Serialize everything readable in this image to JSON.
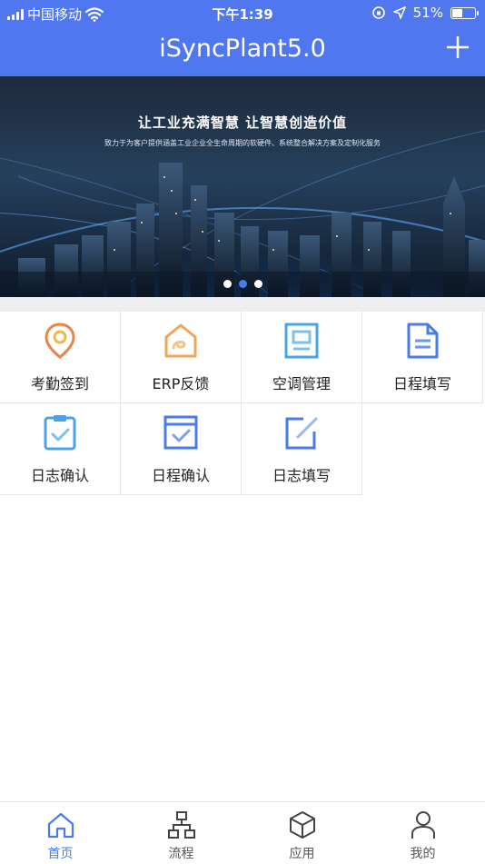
{
  "status_bar": {
    "carrier": "中国移动",
    "time": "下午1:39",
    "battery": "51%",
    "battery_level": 0.51
  },
  "header": {
    "title": "iSyncPlant5.0",
    "add_icon": "plus-icon"
  },
  "banner": {
    "title": "让工业充满智慧 让智慧创造价值",
    "subtitle": "致力于为客户提供涵盖工业企业全生命周期的软硬件、系统整合解决方案及定制化服务",
    "pages": 3,
    "active_page": 2
  },
  "apps": [
    {
      "label": "考勤签到",
      "icon": "location-pin-icon",
      "color": "#e8834a"
    },
    {
      "label": "ERP反馈",
      "icon": "feedback-icon",
      "color": "#f0a55a"
    },
    {
      "label": "空调管理",
      "icon": "aircon-panel-icon",
      "color": "#4aa3e8"
    },
    {
      "label": "日程填写",
      "icon": "document-icon",
      "color": "#4a7be8"
    },
    {
      "label": "日志确认",
      "icon": "clipboard-check-icon",
      "color": "#4aa3e8"
    },
    {
      "label": "日程确认",
      "icon": "calendar-check-icon",
      "color": "#4a7be8"
    },
    {
      "label": "日志填写",
      "icon": "edit-icon",
      "color": "#4a7be8"
    }
  ],
  "tabs": [
    {
      "label": "首页",
      "icon": "home-icon",
      "active": true
    },
    {
      "label": "流程",
      "icon": "flow-icon",
      "active": false
    },
    {
      "label": "应用",
      "icon": "cube-icon",
      "active": false
    },
    {
      "label": "我的",
      "icon": "user-icon",
      "active": false
    }
  ],
  "colors": {
    "brand": "#5077f0",
    "active_tab": "#4a7be8"
  }
}
